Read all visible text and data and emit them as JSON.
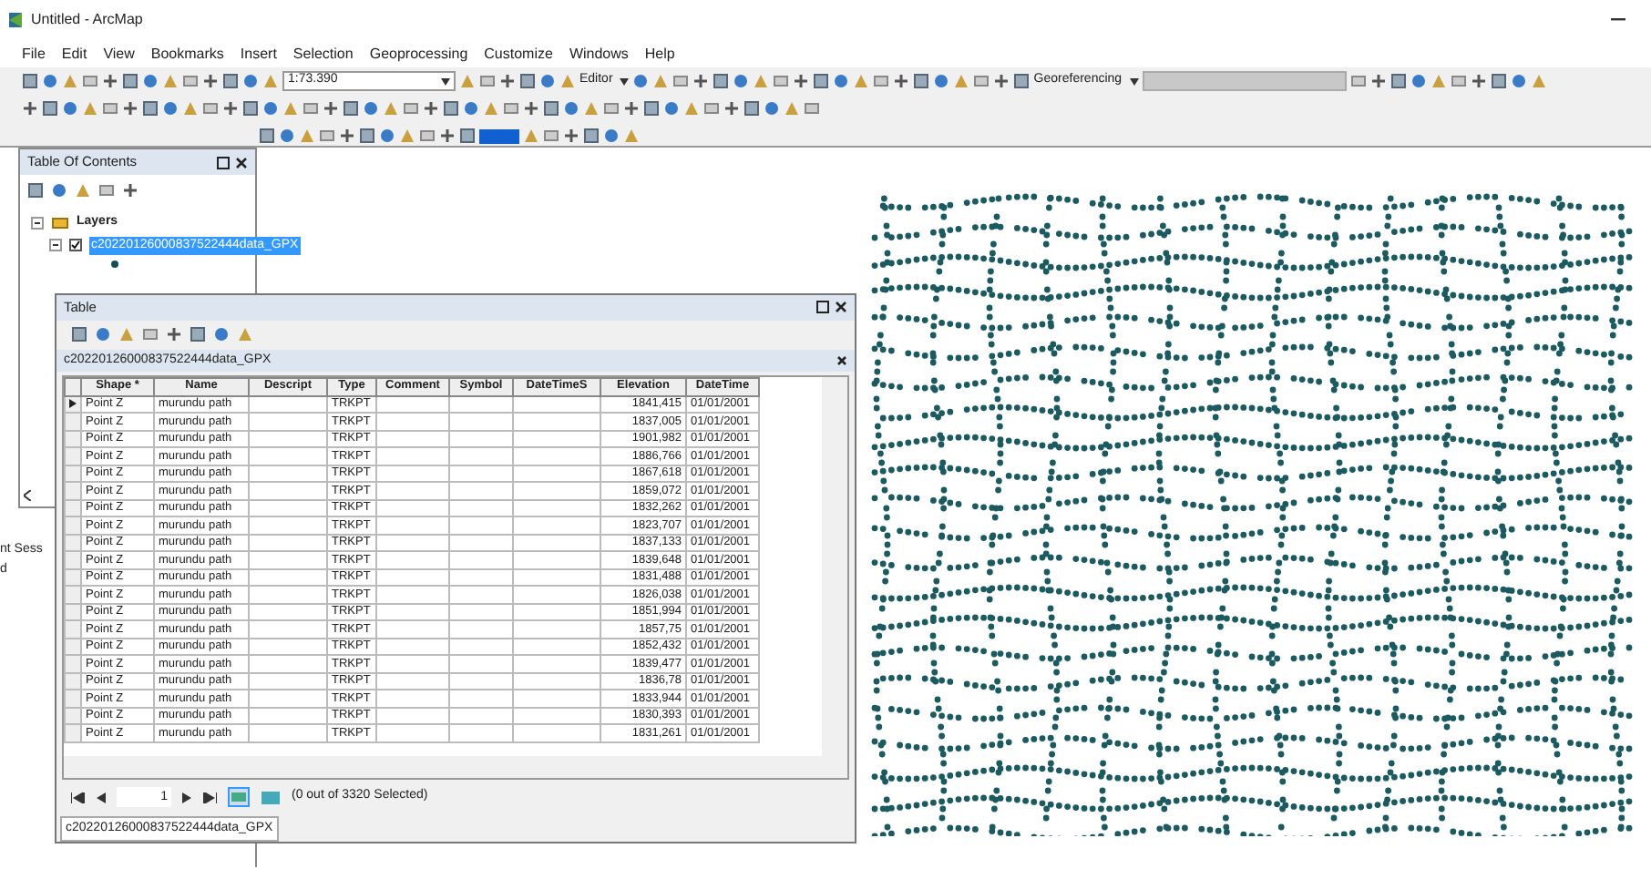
{
  "window": {
    "title": "Untitled - ArcMap"
  },
  "menu": [
    "File",
    "Edit",
    "View",
    "Bookmarks",
    "Insert",
    "Selection",
    "Geoprocessing",
    "Customize",
    "Windows",
    "Help"
  ],
  "toolbar": {
    "scale": "1:73.390",
    "editor": "Editor",
    "georeferencing": "Georeferencing"
  },
  "toc": {
    "title": "Table Of Contents",
    "layers": [
      {
        "label": "Layers",
        "expanded": true,
        "children": [
          {
            "label": "c20220126000837522444data_GPX",
            "checked": true,
            "selected": true,
            "expanded": true
          }
        ]
      }
    ]
  },
  "side_texts": [
    "nt Sess",
    "d"
  ],
  "table_window": {
    "title": "Table",
    "layer_tab": "c20220126000837522444data_GPX",
    "columns": [
      "Shape *",
      "Name",
      "Descript",
      "Type",
      "Comment",
      "Symbol",
      "DateTimeS",
      "Elevation",
      "DateTime"
    ],
    "rows": [
      {
        "current": true,
        "shape": "Point Z",
        "name": "murundu path",
        "type": "TRKPT",
        "elevation": "1841,415",
        "datetime": "01/01/2001"
      },
      {
        "current": false,
        "shape": "Point Z",
        "name": "murundu path",
        "type": "TRKPT",
        "elevation": "1837,005",
        "datetime": "01/01/2001"
      },
      {
        "current": false,
        "shape": "Point Z",
        "name": "murundu path",
        "type": "TRKPT",
        "elevation": "1901,982",
        "datetime": "01/01/2001"
      },
      {
        "current": false,
        "shape": "Point Z",
        "name": "murundu path",
        "type": "TRKPT",
        "elevation": "1886,766",
        "datetime": "01/01/2001"
      },
      {
        "current": false,
        "shape": "Point Z",
        "name": "murundu path",
        "type": "TRKPT",
        "elevation": "1867,618",
        "datetime": "01/01/2001"
      },
      {
        "current": false,
        "shape": "Point Z",
        "name": "murundu path",
        "type": "TRKPT",
        "elevation": "1859,072",
        "datetime": "01/01/2001"
      },
      {
        "current": false,
        "shape": "Point Z",
        "name": "murundu path",
        "type": "TRKPT",
        "elevation": "1832,262",
        "datetime": "01/01/2001"
      },
      {
        "current": false,
        "shape": "Point Z",
        "name": "murundu path",
        "type": "TRKPT",
        "elevation": "1823,707",
        "datetime": "01/01/2001"
      },
      {
        "current": false,
        "shape": "Point Z",
        "name": "murundu path",
        "type": "TRKPT",
        "elevation": "1837,133",
        "datetime": "01/01/2001"
      },
      {
        "current": false,
        "shape": "Point Z",
        "name": "murundu path",
        "type": "TRKPT",
        "elevation": "1839,648",
        "datetime": "01/01/2001"
      },
      {
        "current": false,
        "shape": "Point Z",
        "name": "murundu path",
        "type": "TRKPT",
        "elevation": "1831,488",
        "datetime": "01/01/2001"
      },
      {
        "current": false,
        "shape": "Point Z",
        "name": "murundu path",
        "type": "TRKPT",
        "elevation": "1826,038",
        "datetime": "01/01/2001"
      },
      {
        "current": false,
        "shape": "Point Z",
        "name": "murundu path",
        "type": "TRKPT",
        "elevation": "1851,994",
        "datetime": "01/01/2001"
      },
      {
        "current": false,
        "shape": "Point Z",
        "name": "murundu path",
        "type": "TRKPT",
        "elevation": "1857,75",
        "datetime": "01/01/2001"
      },
      {
        "current": false,
        "shape": "Point Z",
        "name": "murundu path",
        "type": "TRKPT",
        "elevation": "1852,432",
        "datetime": "01/01/2001"
      },
      {
        "current": false,
        "shape": "Point Z",
        "name": "murundu path",
        "type": "TRKPT",
        "elevation": "1839,477",
        "datetime": "01/01/2001"
      },
      {
        "current": false,
        "shape": "Point Z",
        "name": "murundu path",
        "type": "TRKPT",
        "elevation": "1836,78",
        "datetime": "01/01/2001"
      },
      {
        "current": false,
        "shape": "Point Z",
        "name": "murundu path",
        "type": "TRKPT",
        "elevation": "1833,944",
        "datetime": "01/01/2001"
      },
      {
        "current": false,
        "shape": "Point Z",
        "name": "murundu path",
        "type": "TRKPT",
        "elevation": "1830,393",
        "datetime": "01/01/2001"
      },
      {
        "current": false,
        "shape": "Point Z",
        "name": "murundu path",
        "type": "TRKPT",
        "elevation": "1831,261",
        "datetime": "01/01/2001"
      }
    ],
    "page": "1",
    "selection_status": "(0 out of 3320 Selected)",
    "bottom_tab": "c20220126000837522444data_GPX"
  }
}
